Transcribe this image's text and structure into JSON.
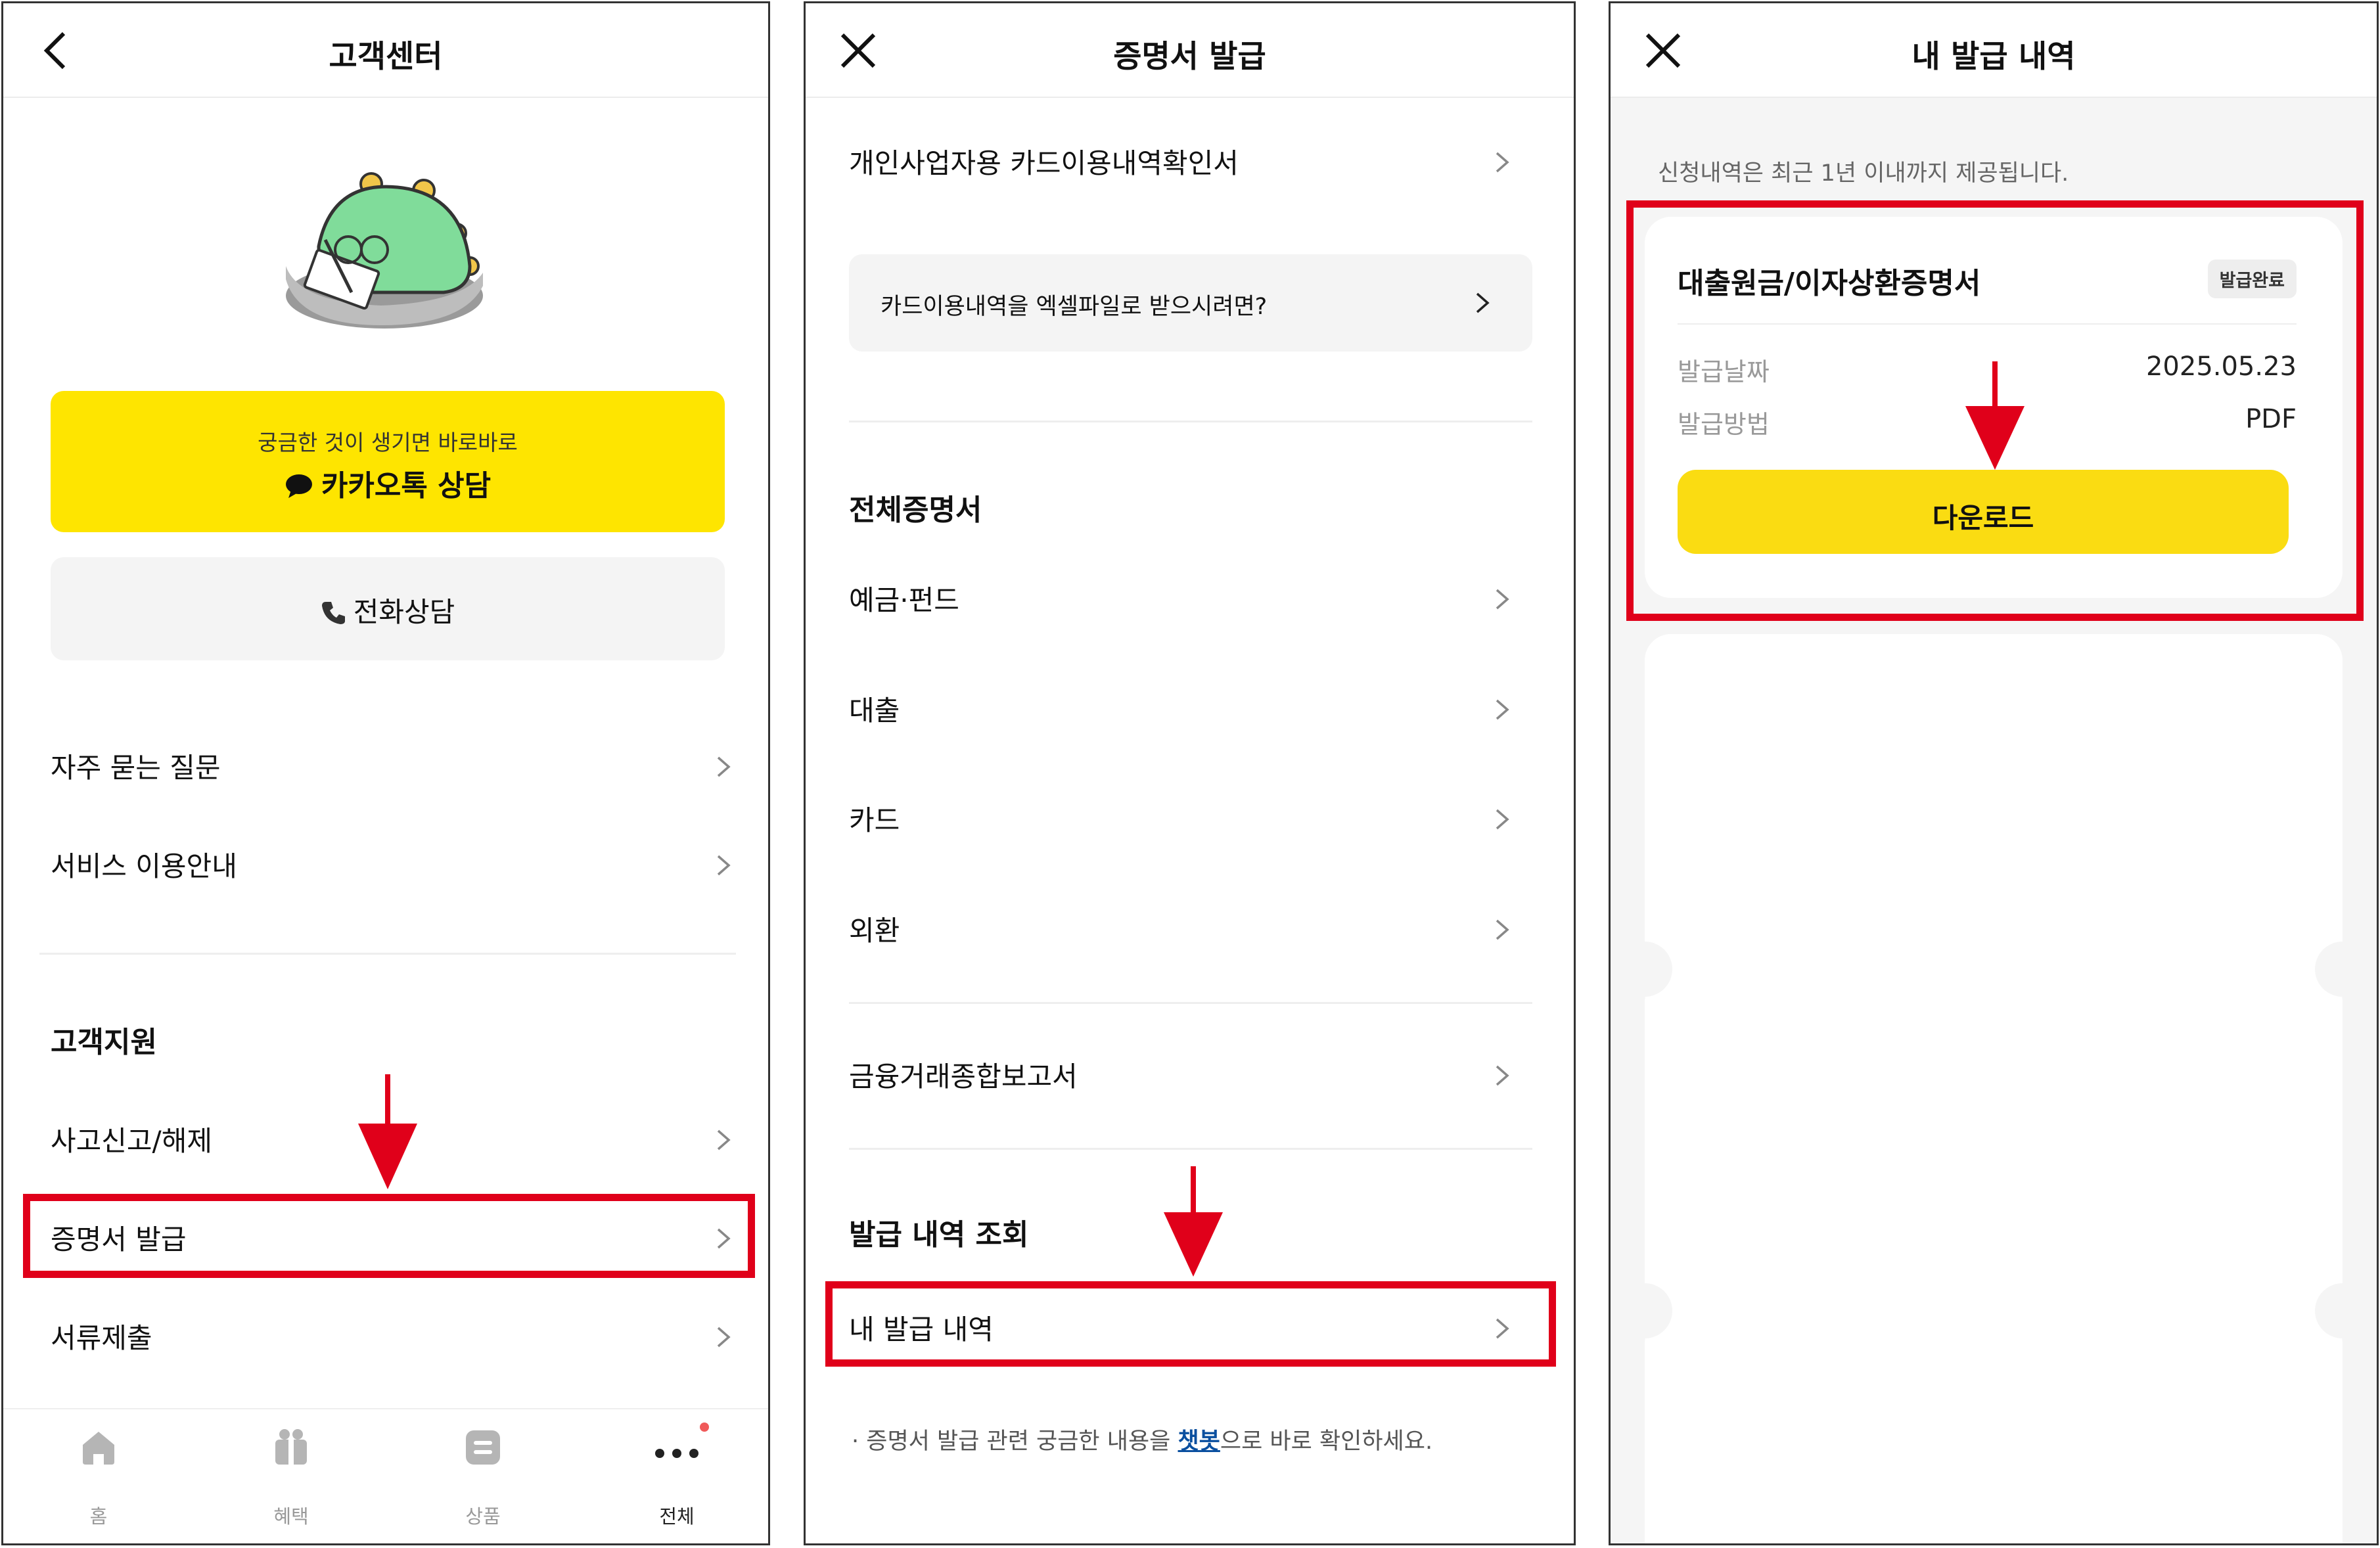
{
  "panel1": {
    "title": "고객센터",
    "kakao": {
      "sub": "궁금한 것이 생기면 바로바로",
      "label": "카카오톡 상담"
    },
    "phone": {
      "label": "전화상담"
    },
    "menu": [
      {
        "label": "자주 묻는 질문"
      },
      {
        "label": "서비스 이용안내"
      }
    ],
    "support_title": "고객지원",
    "support": [
      {
        "label": "사고신고/해제"
      },
      {
        "label": "증명서 발급"
      },
      {
        "label": "서류제출"
      }
    ],
    "tabs": [
      {
        "label": "홈",
        "icon": "home-icon"
      },
      {
        "label": "혜택",
        "icon": "gift-icon"
      },
      {
        "label": "상품",
        "icon": "product-icon"
      },
      {
        "label": "전체",
        "icon": "more-icon"
      }
    ],
    "colors": {
      "kakao": "#fee500",
      "accent_red": "#e0001a",
      "dot": "#f05a5a"
    }
  },
  "panel2": {
    "title": "증명서 발급",
    "top_item": "개인사업자용 카드이용내역확인서",
    "excel": "카드이용내역을 엑셀파일로 받으시려면?",
    "all_title": "전체증명서",
    "items": [
      {
        "label": "예금·펀드"
      },
      {
        "label": "대출"
      },
      {
        "label": "카드"
      },
      {
        "label": "외환"
      }
    ],
    "report": "금융거래종합보고서",
    "history_title": "발급 내역 조회",
    "history_item": "내 발급 내역",
    "note_pre": "· 증명서 발급 관련 궁금한 내용을 ",
    "note_link": "챗봇",
    "note_post": "으로 바로 확인하세요."
  },
  "panel3": {
    "title": "내 발급 내역",
    "info": "신청내역은 최근 1년 이내까지 제공됩니다.",
    "card": {
      "title": "대출원금/이자상환증명서",
      "badge": "발급완료",
      "date_label": "발급날짜",
      "date_value": "2025.05.23",
      "method_label": "발급방법",
      "method_value": "PDF",
      "download": "다운로드"
    }
  }
}
